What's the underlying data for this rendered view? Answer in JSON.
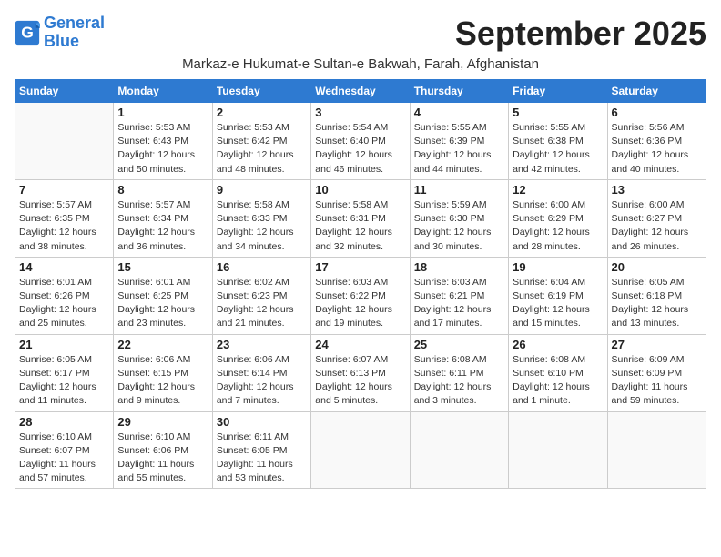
{
  "logo": {
    "line1": "General",
    "line2": "Blue"
  },
  "title": "September 2025",
  "subtitle": "Markaz-e Hukumat-e Sultan-e Bakwah, Farah, Afghanistan",
  "weekdays": [
    "Sunday",
    "Monday",
    "Tuesday",
    "Wednesday",
    "Thursday",
    "Friday",
    "Saturday"
  ],
  "weeks": [
    [
      {
        "num": "",
        "info": ""
      },
      {
        "num": "1",
        "info": "Sunrise: 5:53 AM\nSunset: 6:43 PM\nDaylight: 12 hours\nand 50 minutes."
      },
      {
        "num": "2",
        "info": "Sunrise: 5:53 AM\nSunset: 6:42 PM\nDaylight: 12 hours\nand 48 minutes."
      },
      {
        "num": "3",
        "info": "Sunrise: 5:54 AM\nSunset: 6:40 PM\nDaylight: 12 hours\nand 46 minutes."
      },
      {
        "num": "4",
        "info": "Sunrise: 5:55 AM\nSunset: 6:39 PM\nDaylight: 12 hours\nand 44 minutes."
      },
      {
        "num": "5",
        "info": "Sunrise: 5:55 AM\nSunset: 6:38 PM\nDaylight: 12 hours\nand 42 minutes."
      },
      {
        "num": "6",
        "info": "Sunrise: 5:56 AM\nSunset: 6:36 PM\nDaylight: 12 hours\nand 40 minutes."
      }
    ],
    [
      {
        "num": "7",
        "info": "Sunrise: 5:57 AM\nSunset: 6:35 PM\nDaylight: 12 hours\nand 38 minutes."
      },
      {
        "num": "8",
        "info": "Sunrise: 5:57 AM\nSunset: 6:34 PM\nDaylight: 12 hours\nand 36 minutes."
      },
      {
        "num": "9",
        "info": "Sunrise: 5:58 AM\nSunset: 6:33 PM\nDaylight: 12 hours\nand 34 minutes."
      },
      {
        "num": "10",
        "info": "Sunrise: 5:58 AM\nSunset: 6:31 PM\nDaylight: 12 hours\nand 32 minutes."
      },
      {
        "num": "11",
        "info": "Sunrise: 5:59 AM\nSunset: 6:30 PM\nDaylight: 12 hours\nand 30 minutes."
      },
      {
        "num": "12",
        "info": "Sunrise: 6:00 AM\nSunset: 6:29 PM\nDaylight: 12 hours\nand 28 minutes."
      },
      {
        "num": "13",
        "info": "Sunrise: 6:00 AM\nSunset: 6:27 PM\nDaylight: 12 hours\nand 26 minutes."
      }
    ],
    [
      {
        "num": "14",
        "info": "Sunrise: 6:01 AM\nSunset: 6:26 PM\nDaylight: 12 hours\nand 25 minutes."
      },
      {
        "num": "15",
        "info": "Sunrise: 6:01 AM\nSunset: 6:25 PM\nDaylight: 12 hours\nand 23 minutes."
      },
      {
        "num": "16",
        "info": "Sunrise: 6:02 AM\nSunset: 6:23 PM\nDaylight: 12 hours\nand 21 minutes."
      },
      {
        "num": "17",
        "info": "Sunrise: 6:03 AM\nSunset: 6:22 PM\nDaylight: 12 hours\nand 19 minutes."
      },
      {
        "num": "18",
        "info": "Sunrise: 6:03 AM\nSunset: 6:21 PM\nDaylight: 12 hours\nand 17 minutes."
      },
      {
        "num": "19",
        "info": "Sunrise: 6:04 AM\nSunset: 6:19 PM\nDaylight: 12 hours\nand 15 minutes."
      },
      {
        "num": "20",
        "info": "Sunrise: 6:05 AM\nSunset: 6:18 PM\nDaylight: 12 hours\nand 13 minutes."
      }
    ],
    [
      {
        "num": "21",
        "info": "Sunrise: 6:05 AM\nSunset: 6:17 PM\nDaylight: 12 hours\nand 11 minutes."
      },
      {
        "num": "22",
        "info": "Sunrise: 6:06 AM\nSunset: 6:15 PM\nDaylight: 12 hours\nand 9 minutes."
      },
      {
        "num": "23",
        "info": "Sunrise: 6:06 AM\nSunset: 6:14 PM\nDaylight: 12 hours\nand 7 minutes."
      },
      {
        "num": "24",
        "info": "Sunrise: 6:07 AM\nSunset: 6:13 PM\nDaylight: 12 hours\nand 5 minutes."
      },
      {
        "num": "25",
        "info": "Sunrise: 6:08 AM\nSunset: 6:11 PM\nDaylight: 12 hours\nand 3 minutes."
      },
      {
        "num": "26",
        "info": "Sunrise: 6:08 AM\nSunset: 6:10 PM\nDaylight: 12 hours\nand 1 minute."
      },
      {
        "num": "27",
        "info": "Sunrise: 6:09 AM\nSunset: 6:09 PM\nDaylight: 11 hours\nand 59 minutes."
      }
    ],
    [
      {
        "num": "28",
        "info": "Sunrise: 6:10 AM\nSunset: 6:07 PM\nDaylight: 11 hours\nand 57 minutes."
      },
      {
        "num": "29",
        "info": "Sunrise: 6:10 AM\nSunset: 6:06 PM\nDaylight: 11 hours\nand 55 minutes."
      },
      {
        "num": "30",
        "info": "Sunrise: 6:11 AM\nSunset: 6:05 PM\nDaylight: 11 hours\nand 53 minutes."
      },
      {
        "num": "",
        "info": ""
      },
      {
        "num": "",
        "info": ""
      },
      {
        "num": "",
        "info": ""
      },
      {
        "num": "",
        "info": ""
      }
    ]
  ]
}
